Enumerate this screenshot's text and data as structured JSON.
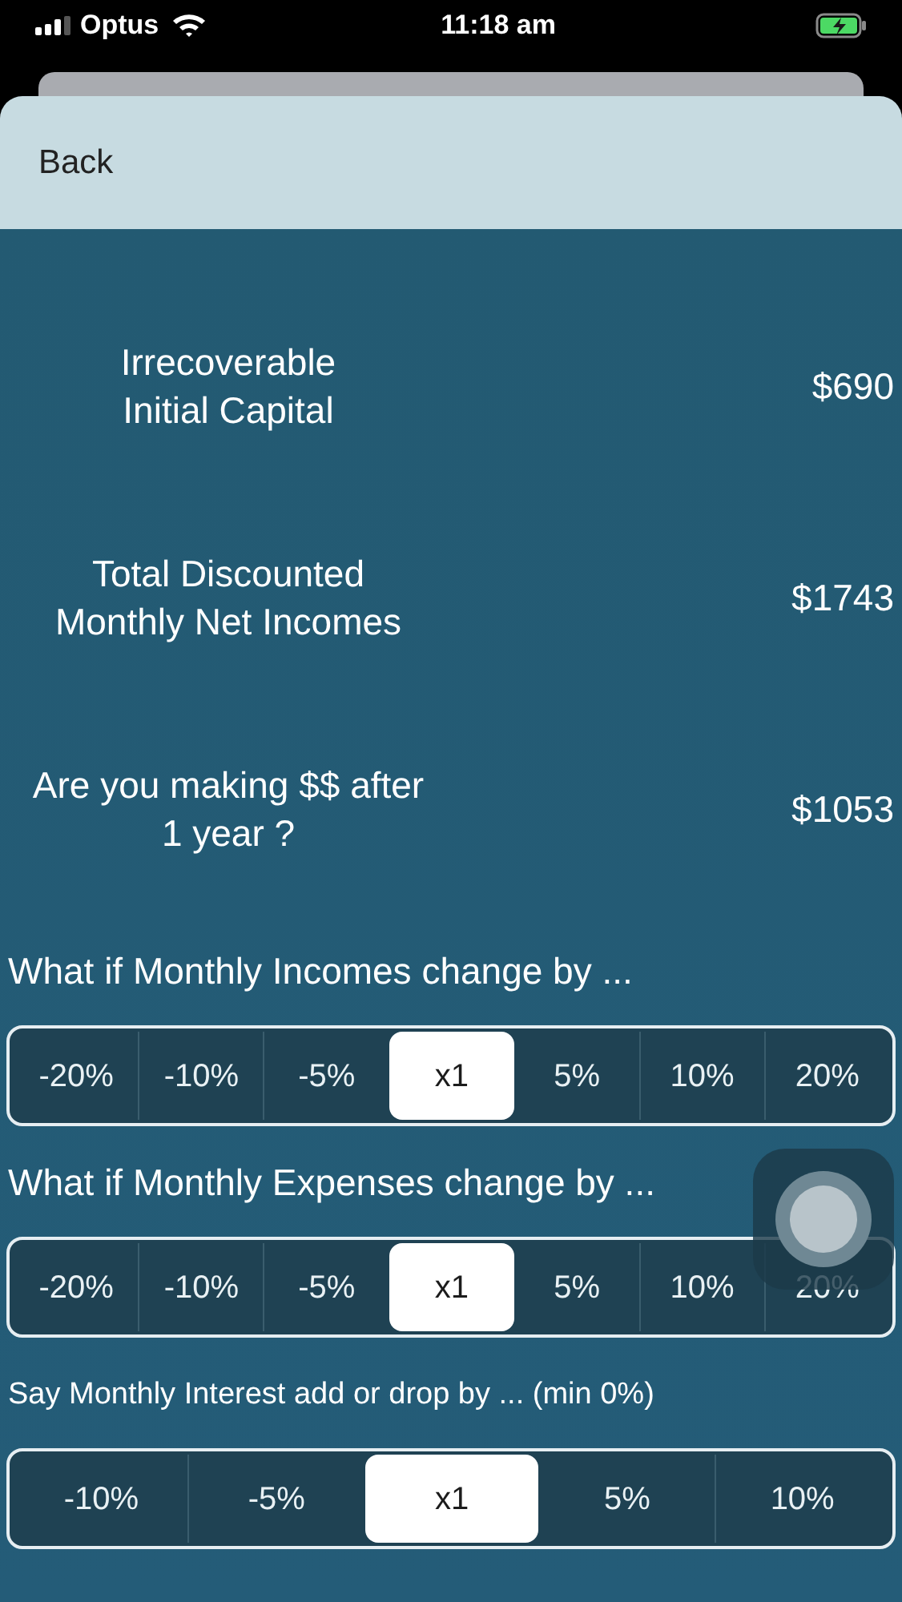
{
  "status_bar": {
    "carrier": "Optus",
    "time": "11:18 am"
  },
  "back_button": "Back",
  "metrics": [
    {
      "label": "Irrecoverable\nInitial Capital",
      "value": "$690"
    },
    {
      "label": "Total Discounted\nMonthly Net Incomes",
      "value": "$1743"
    },
    {
      "label": "Are you making $$ after\n1 year ?",
      "value": "$1053"
    }
  ],
  "questions": [
    {
      "prompt": "What if Monthly Incomes change by ...",
      "options": [
        {
          "label": "-20%",
          "selected": false
        },
        {
          "label": "-10%",
          "selected": false
        },
        {
          "label": "-5%",
          "selected": false
        },
        {
          "label": "x1",
          "selected": true
        },
        {
          "label": "5%",
          "selected": false
        },
        {
          "label": "10%",
          "selected": false
        },
        {
          "label": "20%",
          "selected": false
        }
      ]
    },
    {
      "prompt": "What if Monthly Expenses change by ...",
      "options": [
        {
          "label": "-20%",
          "selected": false
        },
        {
          "label": "-10%",
          "selected": false
        },
        {
          "label": "-5%",
          "selected": false
        },
        {
          "label": "x1",
          "selected": true
        },
        {
          "label": "5%",
          "selected": false
        },
        {
          "label": "10%",
          "selected": false
        },
        {
          "label": "20%",
          "selected": false
        }
      ]
    },
    {
      "prompt": "Say Monthly Interest add or drop by ... (min 0%)",
      "options": [
        {
          "label": "-10%",
          "selected": false
        },
        {
          "label": "-5%",
          "selected": false
        },
        {
          "label": "x1",
          "selected": true
        },
        {
          "label": "5%",
          "selected": false
        },
        {
          "label": "10%",
          "selected": false
        }
      ]
    }
  ]
}
